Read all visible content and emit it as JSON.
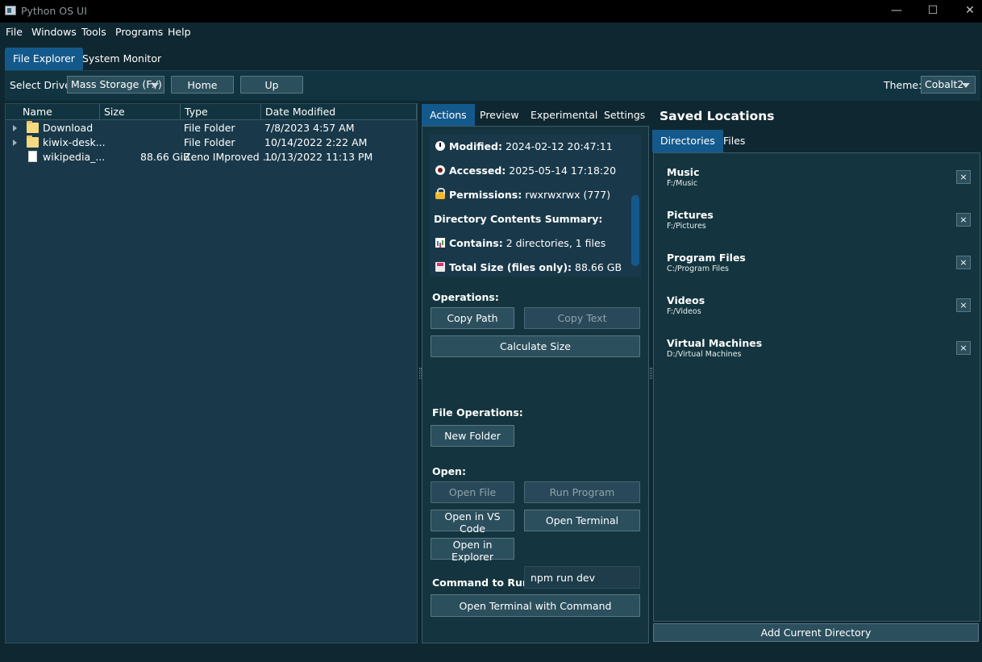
{
  "window": {
    "title": "Python OS UI",
    "controls": {
      "minimize": "—",
      "maximize": "☐",
      "close": "✕"
    }
  },
  "menu": [
    "File",
    "Windows",
    "Tools",
    "Programs",
    "Help"
  ],
  "main_tabs": [
    {
      "label": "File Explorer",
      "active": true
    },
    {
      "label": "System Monitor",
      "active": false
    }
  ],
  "toolbar": {
    "drive_label": "Select Drive:",
    "drive_value": "Mass Storage (F:/)",
    "home_label": "Home",
    "up_label": "Up",
    "theme_label": "Theme:",
    "theme_value": "Cobalt2"
  },
  "tree": {
    "columns": [
      "Name",
      "Size",
      "Type",
      "Date Modified"
    ],
    "rows": [
      {
        "name": "Download",
        "size": "",
        "type": "File Folder",
        "date": "7/8/2023 4:57 AM",
        "kind": "folder"
      },
      {
        "name": "kiwix-desk...",
        "size": "",
        "type": "File Folder",
        "date": "10/14/2022 2:22 AM",
        "kind": "folder"
      },
      {
        "name": "wikipedia_...",
        "size": "88.66 GiB",
        "type": "Zeno IMproved ...",
        "date": "10/13/2022 11:13 PM",
        "kind": "file"
      }
    ]
  },
  "middle": {
    "tabs": [
      "Actions",
      "Preview",
      "Experimental",
      "Settings"
    ],
    "info": {
      "modified_label": "Modified:",
      "modified_value": "2024-02-12 20:47:11",
      "accessed_label": "Accessed:",
      "accessed_value": "2025-05-14 17:18:20",
      "permissions_label": "Permissions:",
      "permissions_value": "rwxrwxrwx (777)",
      "summary_heading": "Directory Contents Summary:",
      "contains_label": "Contains:",
      "contains_value": "2 directories, 1 files",
      "total_label": "Total Size (files only):",
      "total_value": "88.66 GB"
    },
    "operations_label": "Operations:",
    "copy_path": "Copy Path",
    "copy_text": "Copy Text",
    "calculate_size": "Calculate Size",
    "file_operations_label": "File Operations:",
    "new_folder": "New Folder",
    "open_label": "Open:",
    "open_file": "Open File",
    "run_program": "Run Program",
    "open_vscode": "Open in VS Code",
    "open_terminal": "Open Terminal",
    "open_explorer": "Open in Explorer",
    "command_label": "Command to Run:",
    "command_value": "npm run dev",
    "open_terminal_cmd": "Open Terminal with Command"
  },
  "saved": {
    "title": "Saved Locations",
    "tabs": [
      "Directories",
      "Files"
    ],
    "items": [
      {
        "name": "Music",
        "path": "F:/Music"
      },
      {
        "name": "Pictures",
        "path": "F:/Pictures"
      },
      {
        "name": "Program Files",
        "path": "C:/Program Files"
      },
      {
        "name": "Videos",
        "path": "F:/Videos"
      },
      {
        "name": "Virtual Machines",
        "path": "D:/Virtual Machines"
      }
    ],
    "remove_glyph": "×",
    "add_current": "Add Current Directory"
  },
  "colors": {
    "background": "#0f2730",
    "accent": "#14598c",
    "panel": "#19394a",
    "button": "#2b4f5d"
  },
  "icons": [
    "folder-icon",
    "file-icon",
    "clock-icon",
    "eye-icon",
    "lock-icon",
    "chart-icon",
    "disk-icon",
    "dropdown-arrow-icon"
  ]
}
